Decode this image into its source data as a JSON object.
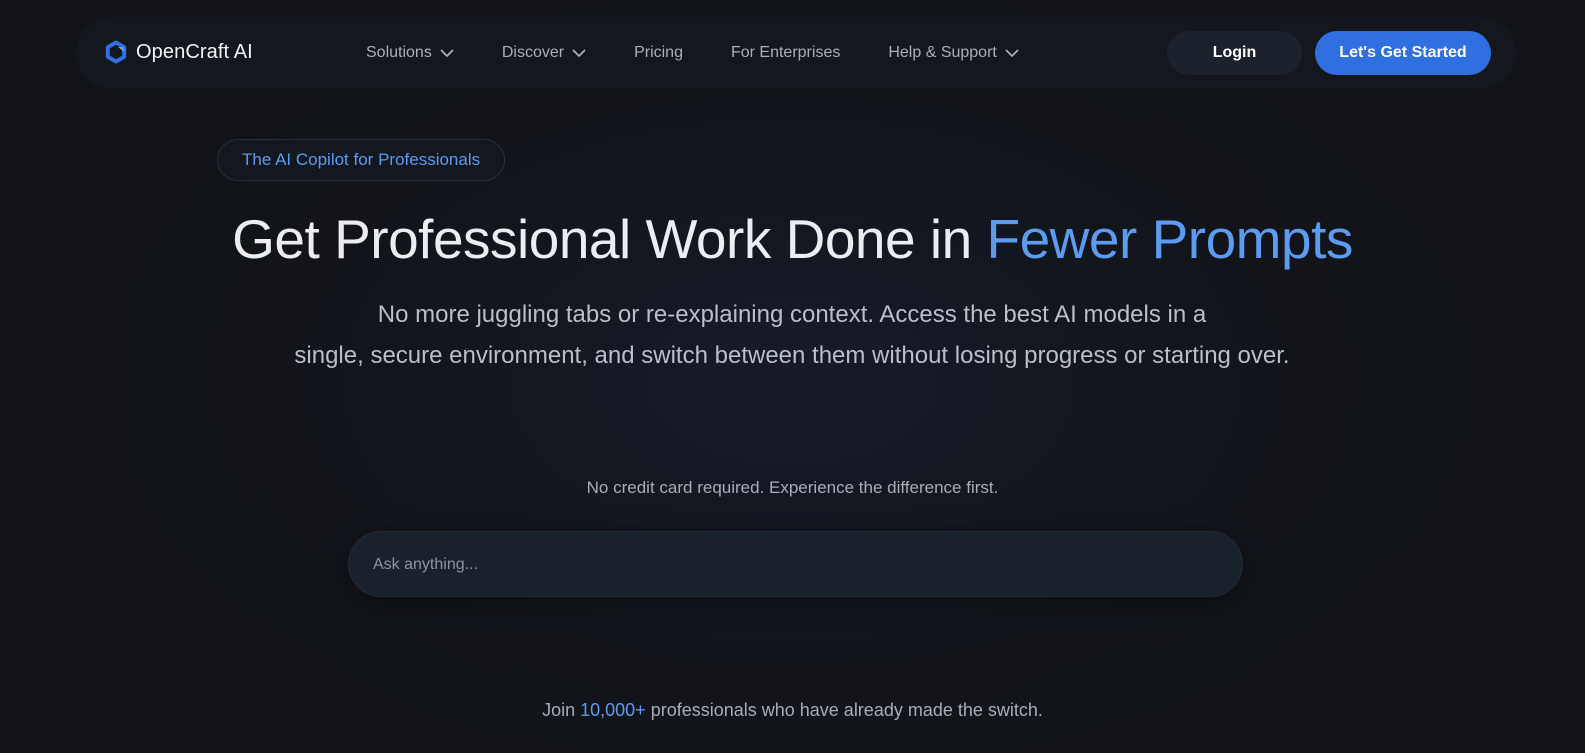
{
  "brand": {
    "name": "OpenCraft AI",
    "accent_color": "#5b9bf2",
    "button_color": "#2f6fe0",
    "logo_icon": "opencraft-logo-icon"
  },
  "nav": {
    "items": [
      {
        "label": "Solutions",
        "has_dropdown": true
      },
      {
        "label": "Discover",
        "has_dropdown": true
      },
      {
        "label": "Pricing",
        "has_dropdown": false
      },
      {
        "label": "For Enterprises",
        "has_dropdown": false
      },
      {
        "label": "Help & Support",
        "has_dropdown": true
      }
    ],
    "login_label": "Login",
    "cta_label": "Let's Get Started"
  },
  "hero": {
    "badge": "The AI Copilot for Professionals",
    "headline_main": "Get Professional Work Done in ",
    "headline_accent": "Fewer Prompts",
    "subtext_line1": "No more juggling tabs or re-explaining context. Access the best AI models in a",
    "subtext_line2": "single, secure environment, and switch between them without losing progress or starting over.",
    "note": "No credit card required. Experience the difference first.",
    "ask_placeholder": "Ask anything...",
    "join_prefix": "Join ",
    "join_count": "10,000+",
    "join_suffix": " professionals who have already made the switch."
  }
}
